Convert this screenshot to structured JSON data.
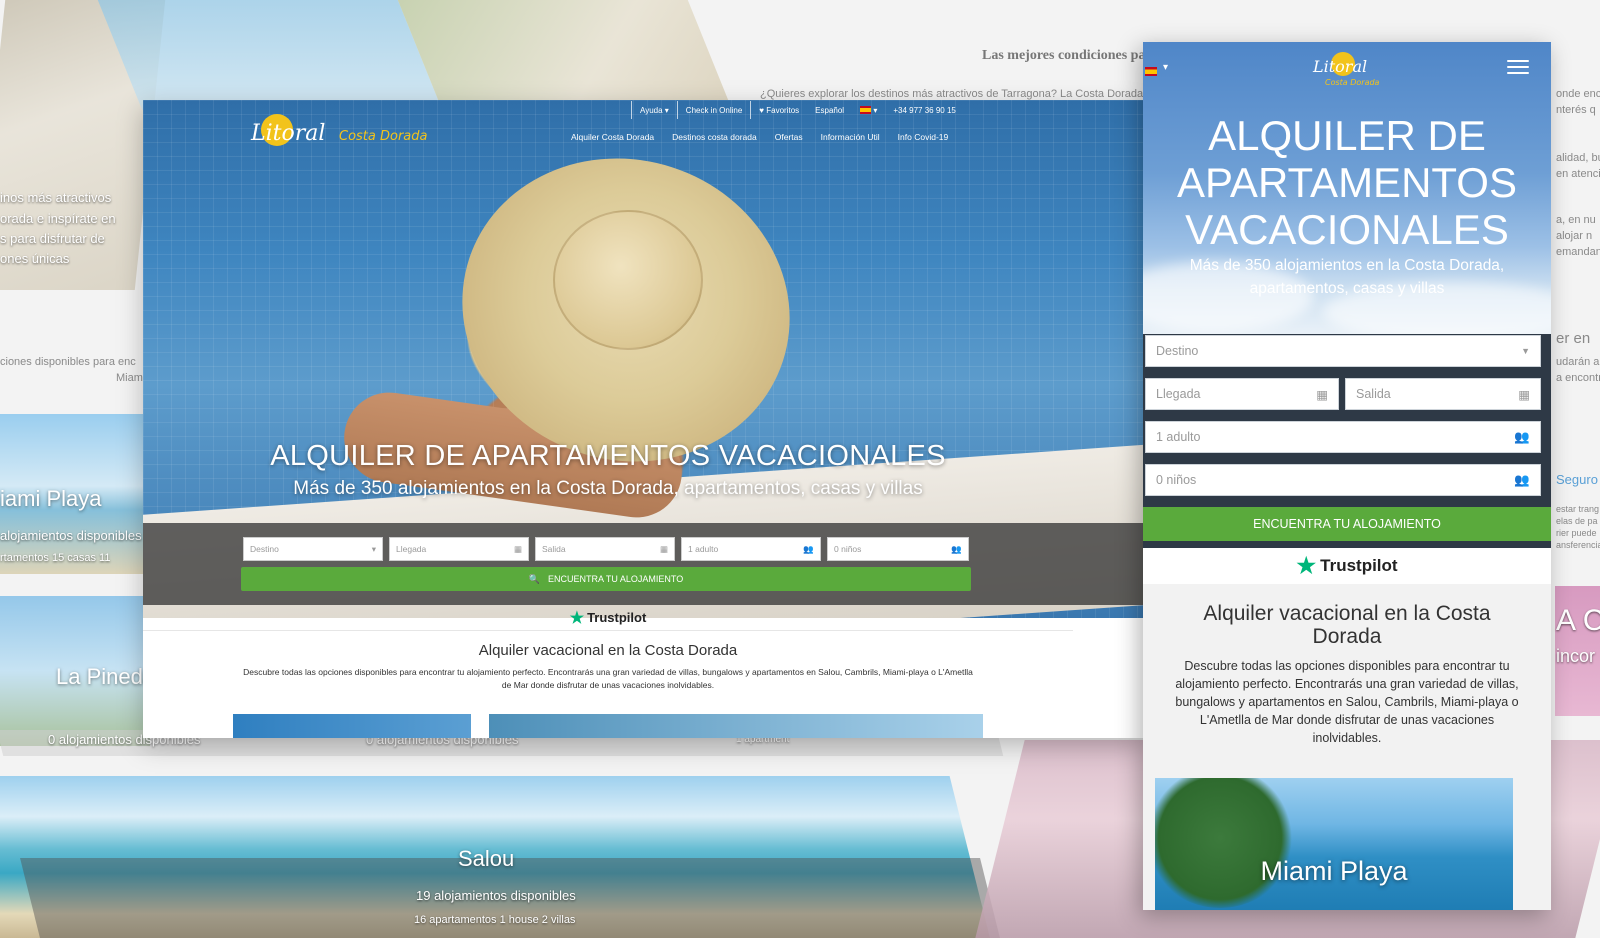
{
  "background": {
    "top_right_title": "Las mejores condiciones pa",
    "top_right_text": "¿Quieres explorar los destinos más atractivos de Tarragona? La Costa Dorada",
    "left_text_lines": [
      "inos más atractivos",
      "orada e inspírate en",
      "s para disfrutar de",
      "ones únicas"
    ],
    "left_mid_text": "ciones disponibles para enc",
    "left_mid_text2": "Miam",
    "miami_label": "iami Playa",
    "miami_count": "alojamientos disponibles",
    "miami_detail": "rtamentos     15 casas     11",
    "pineda_label": "La Pineda",
    "pineda_count": "0 alojamientos disponibles",
    "strip_count": "0 alojamientos disponibles",
    "strip_count2": "1 apartment",
    "salou_label": "Salou",
    "salou_count": "19 alojamientos disponibles",
    "salou_detail": "16 apartamentos     1 house     2 villas",
    "right_lines": [
      "onde enco",
      "nterés q",
      "alidad, bu",
      "en atenci",
      "a, en nu",
      "alojar n",
      "emandan"
    ],
    "right_mid_text": "er en",
    "right_mid_lines": [
      "udarán a c",
      "a encontr"
    ],
    "seguro_label": "Seguro",
    "right_small_lines": [
      "estar trang",
      "elas de pa",
      "rier puede",
      "ansferencia"
    ],
    "right_pink_label": "A C",
    "right_pink_sub": "incor"
  },
  "desktop": {
    "brand": "Litoral",
    "brand_sub": "Costa Dorada",
    "topbar": {
      "help": "Ayuda",
      "checkin": "Check in Online",
      "favorites": "Favoritos",
      "language": "Español",
      "phone": "+34 977 36 90 15"
    },
    "menu": [
      "Alquiler Costa Dorada",
      "Destinos costa dorada",
      "Ofertas",
      "Información Util",
      "Info Covid-19"
    ],
    "hero_title": "ALQUILER DE APARTAMENTOS VACACIONALES",
    "hero_subtitle": "Más de 350 alojamientos en la Costa Dorada, apartamentos, casas y villas",
    "search": {
      "destination": "Destino",
      "arrival": "Llegada",
      "departure": "Salida",
      "adults": "1 adulto",
      "children": "0 niños",
      "button": "ENCUENTRA TU ALOJAMIENTO"
    },
    "trustpilot": "Trustpilot",
    "section_title": "Alquiler vacacional en la Costa Dorada",
    "section_desc": "Descubre todas las opciones disponibles para encontrar tu alojamiento perfecto. Encontrarás una gran variedad de villas, bungalows y apartamentos en Salou, Cambrils, Miami-playa o L'Ametlla de Mar donde disfrutar de unas vacaciones inolvidables."
  },
  "mobile": {
    "brand": "Litoral",
    "brand_sub": "Costa Dorada",
    "hero_title": "ALQUILER DE APARTAMENTOS VACACIONALES",
    "hero_subtitle": "Más de 350 alojamientos en la Costa Dorada, apartamentos, casas y villas",
    "search": {
      "destination": "Destino",
      "arrival": "Llegada",
      "departure": "Salida",
      "adults": "1 adulto",
      "children": "0 niños",
      "button": "ENCUENTRA TU ALOJAMIENTO"
    },
    "trustpilot": "Trustpilot",
    "section_title": "Alquiler vacacional en la Costa Dorada",
    "section_desc": "Descubre todas las opciones disponibles para encontrar tu alojamiento perfecto. Encontrarás una gran variedad de villas, bungalows y apartamentos en Salou, Cambrils, Miami-playa o L'Ametlla de Mar donde disfrutar de unas vacaciones inolvidables.",
    "card_label": "Miami Playa"
  },
  "colors": {
    "accent_green": "#5aaa3c",
    "logo_yellow": "#f2c31b",
    "trustpilot_green": "#00b67a",
    "search_bar": "#373737",
    "mobile_form": "#2e3946"
  }
}
